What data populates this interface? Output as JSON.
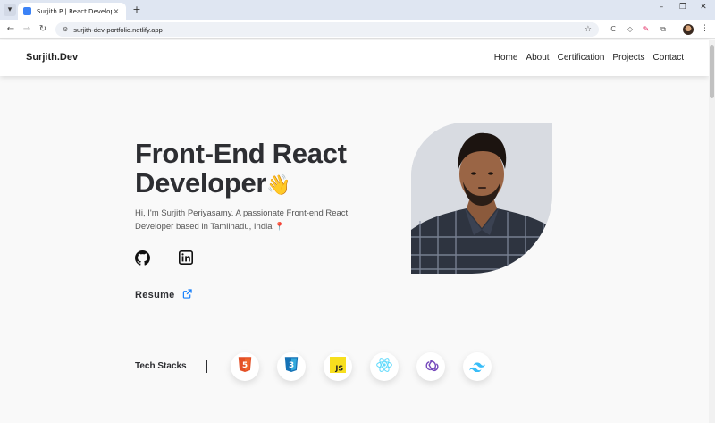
{
  "browser": {
    "tab_title": "Surjith P | React Developer",
    "tab_close": "×",
    "new_tab": "+",
    "url": "surjith-dev-portfolio.netlify.app",
    "controls": {
      "minimize": "–",
      "restore": "❐",
      "close": "✕"
    }
  },
  "site": {
    "brand": "Surjith.Dev",
    "nav": [
      "Home",
      "About",
      "Certification",
      "Projects",
      "Contact"
    ]
  },
  "hero": {
    "title_line1": "Front-End React",
    "title_line2": "Developer",
    "wave_emoji": "👋",
    "description": "Hi, I'm Surjith Periyasamy. A passionate Front-end React Developer based in Tamilnadu, India",
    "pin_emoji": "📍",
    "resume_label": "Resume"
  },
  "tech": {
    "label": "Tech Stacks",
    "items": [
      "html5-icon",
      "css3-icon",
      "javascript-icon",
      "react-icon",
      "redux-icon",
      "tailwind-icon"
    ],
    "js_badge": "JS",
    "html_badge": "5",
    "css_badge": "3"
  },
  "colors": {
    "accent_blue": "#147efb",
    "text_dark": "#2d2e32",
    "html": "#e34f26",
    "css": "#1572b6",
    "js": "#f7df1e",
    "react": "#61dafb",
    "redux": "#764abc",
    "tailwind": "#38bdf8"
  }
}
